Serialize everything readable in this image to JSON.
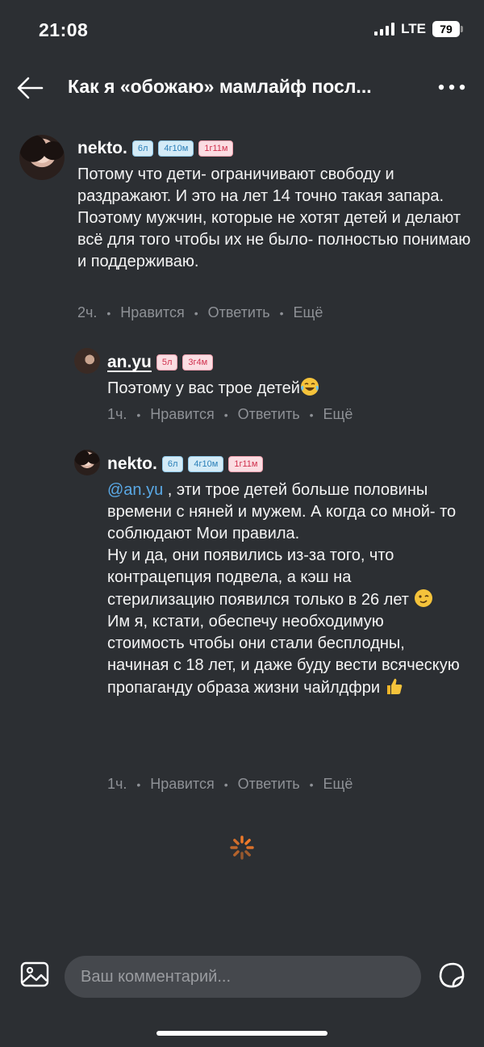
{
  "status_bar": {
    "time": "21:08",
    "network": "LTE",
    "battery": "79"
  },
  "header": {
    "title": "Как я «обожаю» мамлайф посл..."
  },
  "comments": [
    {
      "author": "nekto.",
      "badges": [
        "6л",
        "4г10м",
        "1г11м"
      ],
      "text": [
        "Потому что дети- ограничивают свободу и раздражают. И это на лет 14 точно такая запара. Поэтому мужчин, которые не хотят детей и делают всё для того чтобы их не было- полностью понимаю и поддерживаю."
      ],
      "time": "2ч.",
      "like": "Нравится",
      "reply": "Ответить",
      "more": "Ещё"
    },
    {
      "author": "an.yu",
      "badges": [
        "5л",
        "3г4м"
      ],
      "text": [
        "Поэтому у вас трое детей"
      ],
      "time": "1ч.",
      "like": "Нравится",
      "reply": "Ответить",
      "more": "Ещё"
    },
    {
      "author": "nekto.",
      "badges": [
        "6л",
        "4г10м",
        "1г11м"
      ],
      "mention": "@an.yu",
      "text": [
        " , эти трое детей больше половины времени с няней и мужем. А когда со мной- то соблюдают Мои правила.",
        "Ну и да, они появились из-за того, что контрацепция подвела, а кэш на стерилизацию появился только в 26 лет",
        "Им я, кстати, обеспечу необходимую стоимость чтобы они стали бесплодны, начиная с 18 лет, и даже буду вести всяческую пропаганду образа жизни чайлдфри"
      ],
      "time": "1ч.",
      "like": "Нравится",
      "reply": "Ответить",
      "more": "Ещё"
    }
  ],
  "composer": {
    "placeholder": "Ваш комментарий..."
  },
  "icons": {
    "back": "arrow-left-icon",
    "more": "more-horizontal-icon",
    "spinner": "loading-spinner-icon",
    "image": "image-icon",
    "sticker": "sticker-icon",
    "emoji_laugh": "tears-of-joy-emoji",
    "emoji_wink": "wink-emoji",
    "emoji_thumb": "thumbs-up-emoji"
  },
  "colors": {
    "background": "#2c2f33",
    "mention": "#5aa9e6",
    "meta": "#8e9196",
    "input": "#45484d"
  }
}
